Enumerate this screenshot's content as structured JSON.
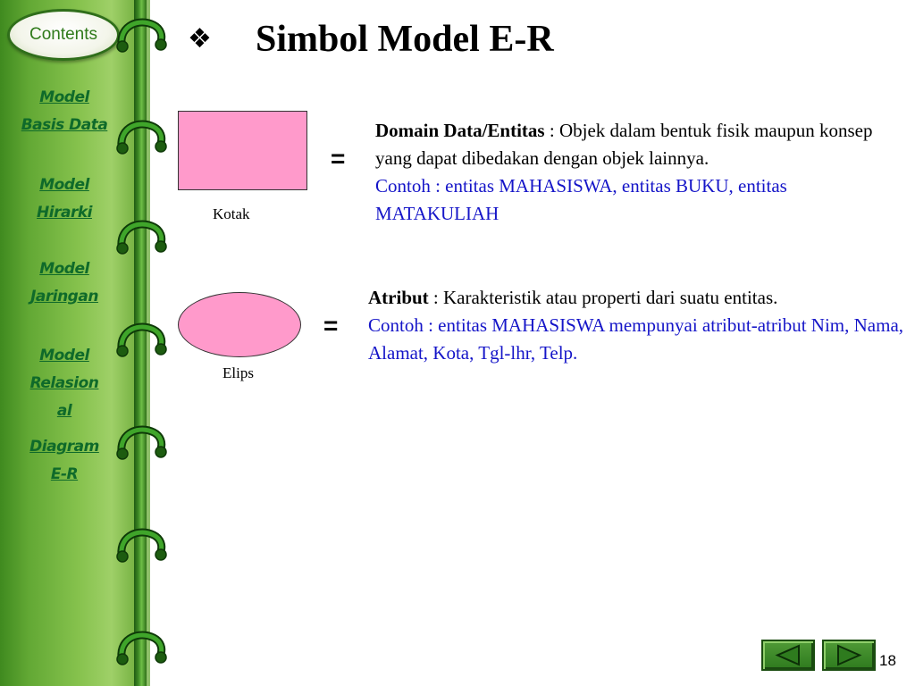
{
  "sidebar": {
    "contents_label": "Contents",
    "links": [
      {
        "lines": [
          "Model",
          "Basis Data"
        ]
      },
      {
        "lines": [
          "Model",
          "Hirarki"
        ]
      },
      {
        "lines": [
          "Model",
          "Jaringan"
        ]
      },
      {
        "lines": [
          "Model",
          "Relasion",
          "al"
        ]
      },
      {
        "lines": [
          "Diagram",
          "E-R"
        ]
      }
    ]
  },
  "slide": {
    "bullet": "❖",
    "title": "Simbol Model E-R",
    "rect_label": "Kotak",
    "ellipse_label": "Elips",
    "eq": "=",
    "entity": {
      "term": "Domain Data/Entitas",
      "definition": " : Objek dalam bentuk fisik maupun konsep  yang dapat dibedakan dengan objek lainnya.",
      "example": "Contoh : entitas MAHASISWA, entitas BUKU, entitas MATAKULIAH"
    },
    "attribute": {
      "term": "Atribut",
      "definition": " : Karakteristik atau properti dari suatu entitas.",
      "example": "Contoh : entitas MAHASISWA mempunyai atribut-atribut Nim, Nama, Alamat, Kota, Tgl-lhr, Telp."
    }
  },
  "footer": {
    "page_number": "18"
  },
  "colors": {
    "sidebar_green": "#86c24d",
    "shape_pink": "#ff9acb",
    "link_green": "#0f6a2a",
    "example_blue": "#1515c8"
  },
  "icons": [
    "prev-arrow-icon",
    "next-arrow-icon",
    "binder-ring-icon",
    "diamond-bullet-icon"
  ]
}
